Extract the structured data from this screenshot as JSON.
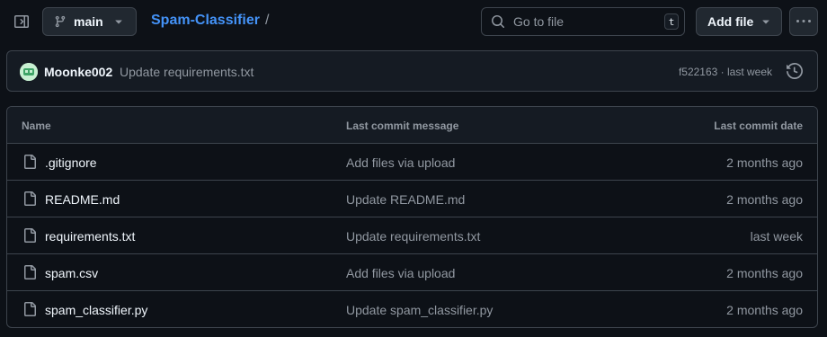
{
  "branch": {
    "label": "main"
  },
  "repo": {
    "name": "Spam-Classifier",
    "separator": "/"
  },
  "search": {
    "placeholder": "Go to file",
    "shortcut": "t"
  },
  "actions": {
    "add_file_label": "Add file"
  },
  "latest_commit": {
    "author": "Moonke002",
    "message": "Update requirements.txt",
    "meta": "f522163 · last week"
  },
  "table": {
    "headers": {
      "name": "Name",
      "message": "Last commit message",
      "date": "Last commit date"
    },
    "rows": [
      {
        "name": ".gitignore",
        "message": "Add files via upload",
        "date": "2 months ago"
      },
      {
        "name": "README.md",
        "message": "Update README.md",
        "date": "2 months ago"
      },
      {
        "name": "requirements.txt",
        "message": "Update requirements.txt",
        "date": "last week"
      },
      {
        "name": "spam.csv",
        "message": "Add files via upload",
        "date": "2 months ago"
      },
      {
        "name": "spam_classifier.py",
        "message": "Update spam_classifier.py",
        "date": "2 months ago"
      }
    ]
  },
  "icons": {
    "sidebar_toggle": "sidebar-toggle-icon",
    "branch": "git-branch-icon",
    "search": "search-icon",
    "more": "kebab-horizontal-icon",
    "history": "history-icon",
    "file": "file-icon"
  },
  "colors": {
    "link": "#4493f8",
    "background": "#0d1117",
    "border": "#3d444d"
  }
}
